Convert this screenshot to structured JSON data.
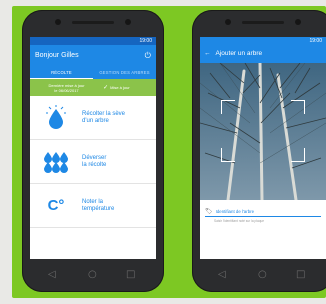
{
  "status_bar": {
    "time": "19:00"
  },
  "left_screen": {
    "title": "Bonjour Gilles",
    "power_icon": "power-icon",
    "tabs": [
      {
        "label": "RÉCOLTE"
      },
      {
        "label": "GESTION DES ARBRES"
      }
    ],
    "sync": {
      "line1": "Dernière mise à jour",
      "line2": "le 06/06/2017",
      "update_label": "Mise à jour"
    },
    "actions": [
      {
        "line1": "Récolter la sève",
        "line2": "d'un arbre",
        "icon": "sap-drop-icon"
      },
      {
        "line1": "Déverser",
        "line2": "la récolte",
        "icon": "multiple-drops-icon"
      },
      {
        "line1": "Noter la",
        "line2": "température",
        "icon": "temperature-icon",
        "symbol": "C°"
      }
    ]
  },
  "right_screen": {
    "title": "Ajouter un arbre",
    "field_placeholder": "Identifiant de l'arbre",
    "field_hint": "Saisir l'identifiant noté sur la plaque"
  },
  "colors": {
    "background_green": "#7dc823",
    "primary_blue": "#1e88e5",
    "sync_green": "#8bc34a"
  }
}
